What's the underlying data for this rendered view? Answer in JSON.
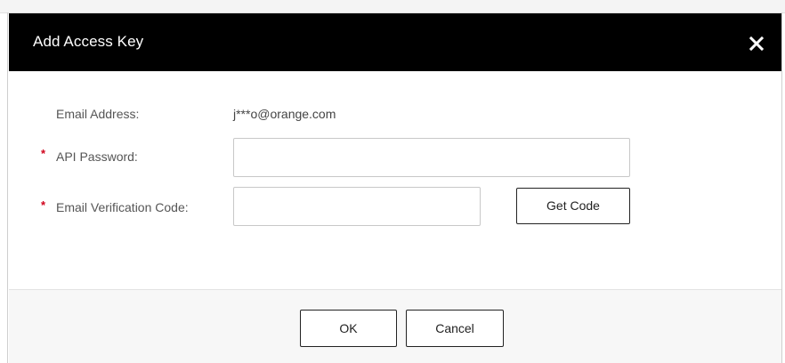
{
  "dialog": {
    "title": "Add Access Key",
    "close_icon": "close-icon"
  },
  "form": {
    "email_label": "Email Address:",
    "email_value": "j***o@orange.com",
    "api_password_label": "API Password:",
    "api_password_value": "",
    "api_password_required_mark": "*",
    "verification_label": "Email Verification Code:",
    "verification_value": "",
    "verification_required_mark": "*",
    "get_code_label": "Get Code"
  },
  "footer": {
    "ok_label": "OK",
    "cancel_label": "Cancel"
  },
  "colors": {
    "header_bg": "#000000",
    "required_mark": "#d0021b",
    "footer_bg": "#f7f7f7"
  }
}
